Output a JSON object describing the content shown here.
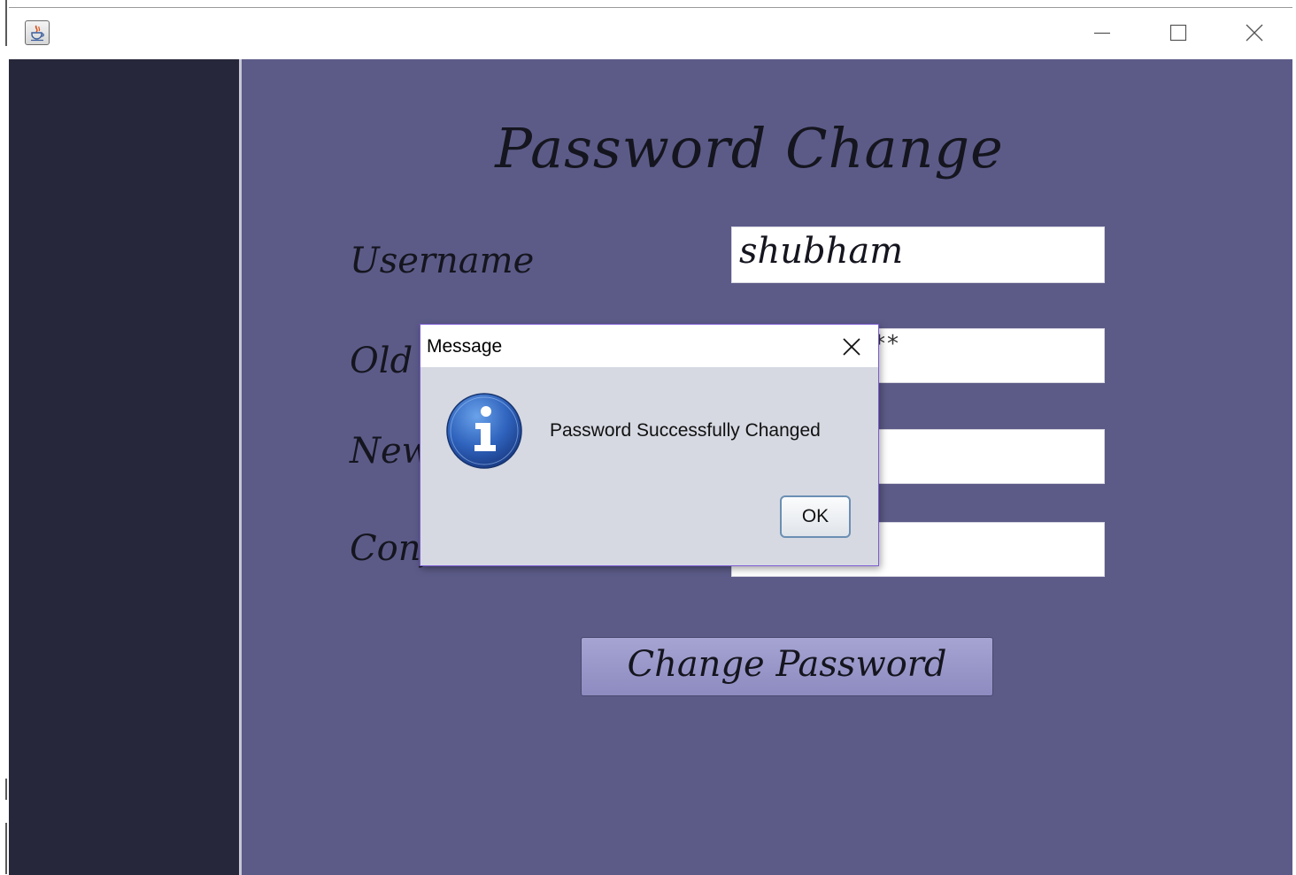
{
  "window": {
    "title_icon": "java-coffee-cup-icon",
    "controls": {
      "minimize_icon": "minimize-icon",
      "maximize_icon": "maximize-icon",
      "close_icon": "close-icon"
    }
  },
  "form": {
    "title": "Password Change",
    "username_label": "Username",
    "username_value": "shubham",
    "old_password_label": "Old Password",
    "old_password_value": "**",
    "new_password_label": "New Password",
    "new_password_value": "",
    "confirm_password_label": "Confirm Password",
    "confirm_password_value": "",
    "submit_label": "Change Password"
  },
  "dialog": {
    "title": "Message",
    "message": "Password Successfully Changed",
    "ok_label": "OK",
    "icon": "info-icon",
    "close_icon": "close-icon"
  },
  "colors": {
    "sidebar": "#27273b",
    "content_background": "#5c5b88",
    "button": "#9a98c9",
    "dialog_background": "#d6d9e2",
    "dialog_border": "#7c5cd2"
  }
}
